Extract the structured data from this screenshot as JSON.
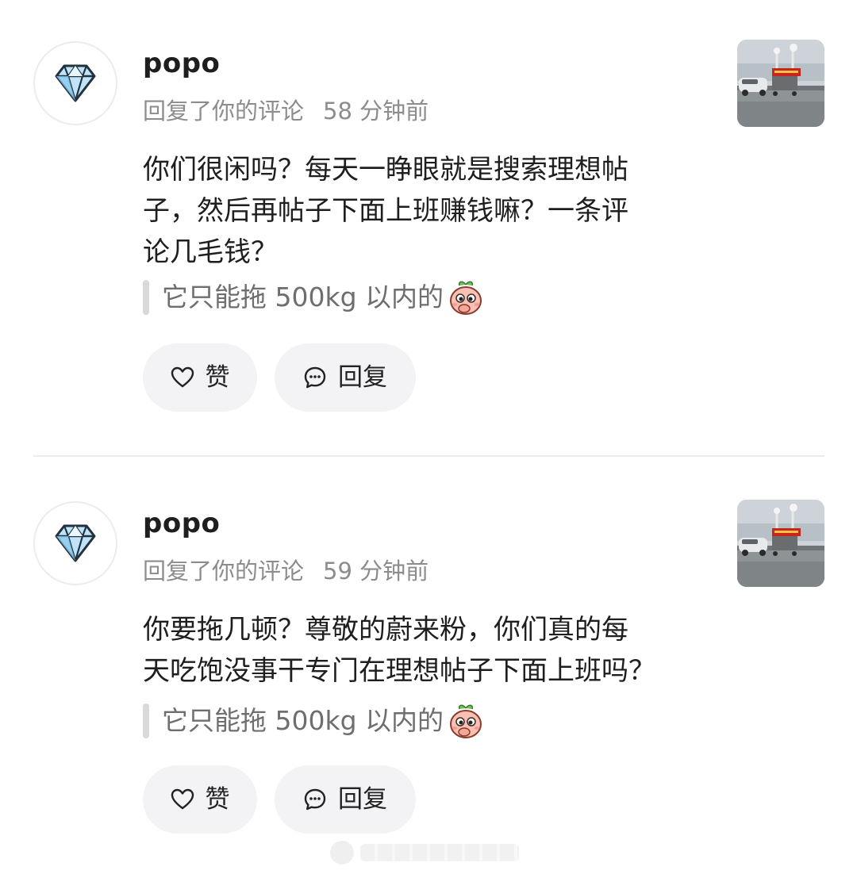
{
  "notifications": [
    {
      "username": "popo",
      "action_text": "回复了你的评论",
      "time": "58 分钟前",
      "comment_lines": [
        "你们很闲吗？每天一睁眼就是搜索理想帖",
        "子，然后再帖子下面上班赚钱嘛？一条评",
        "论几毛钱？"
      ],
      "quoted_text": "它只能拖 500kg 以内的",
      "like_label": "赞",
      "reply_label": "回复"
    },
    {
      "username": "popo",
      "action_text": "回复了你的评论",
      "time": "59 分钟前",
      "comment_lines": [
        "你要拖几顿？尊敬的蔚来粉，你们真的每",
        "天吃饱没事干专门在理想帖子下面上班吗？"
      ],
      "quoted_text": "它只能拖 500kg 以内的",
      "like_label": "赞",
      "reply_label": "回复"
    }
  ],
  "icons": {
    "avatar": "diamond-icon",
    "like": "heart-icon",
    "reply": "comment-bubble-icon",
    "sticker": "peach-sticker-icon"
  },
  "colors": {
    "meta_text": "#8c8c8c",
    "button_bg": "#f3f3f5",
    "quote_bar": "#d9d9d9"
  }
}
